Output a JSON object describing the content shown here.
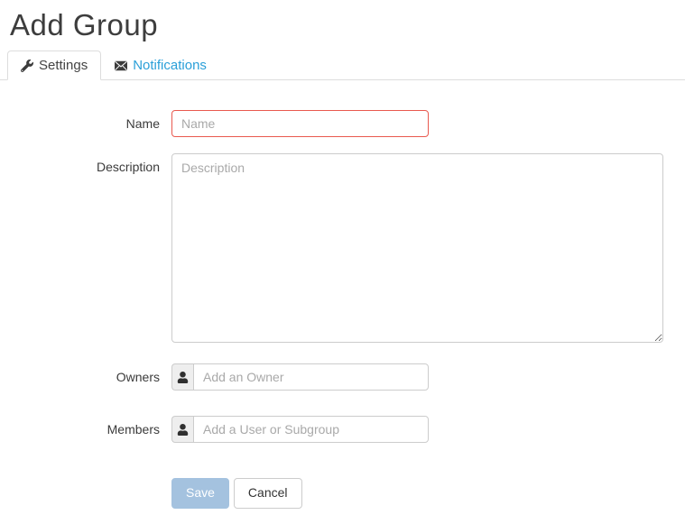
{
  "page": {
    "title": "Add Group"
  },
  "tabs": [
    {
      "label": "Settings",
      "icon": "wrench-icon",
      "active": true
    },
    {
      "label": "Notifications",
      "icon": "envelope-icon",
      "active": false
    }
  ],
  "form": {
    "name": {
      "label": "Name",
      "placeholder": "Name",
      "has_error": true
    },
    "description": {
      "label": "Description",
      "placeholder": "Description"
    },
    "owners": {
      "label": "Owners",
      "placeholder": "Add an Owner",
      "icon": "user-icon"
    },
    "members": {
      "label": "Members",
      "placeholder": "Add a User or Subgroup",
      "icon": "user-icon"
    }
  },
  "buttons": {
    "save": "Save",
    "cancel": "Cancel"
  },
  "colors": {
    "link_blue": "#2a9fd8",
    "error_red": "#e9594f",
    "save_button_bg": "#a4c2df",
    "tab_border": "#dddddd",
    "addon_bg": "#eeeeee"
  }
}
